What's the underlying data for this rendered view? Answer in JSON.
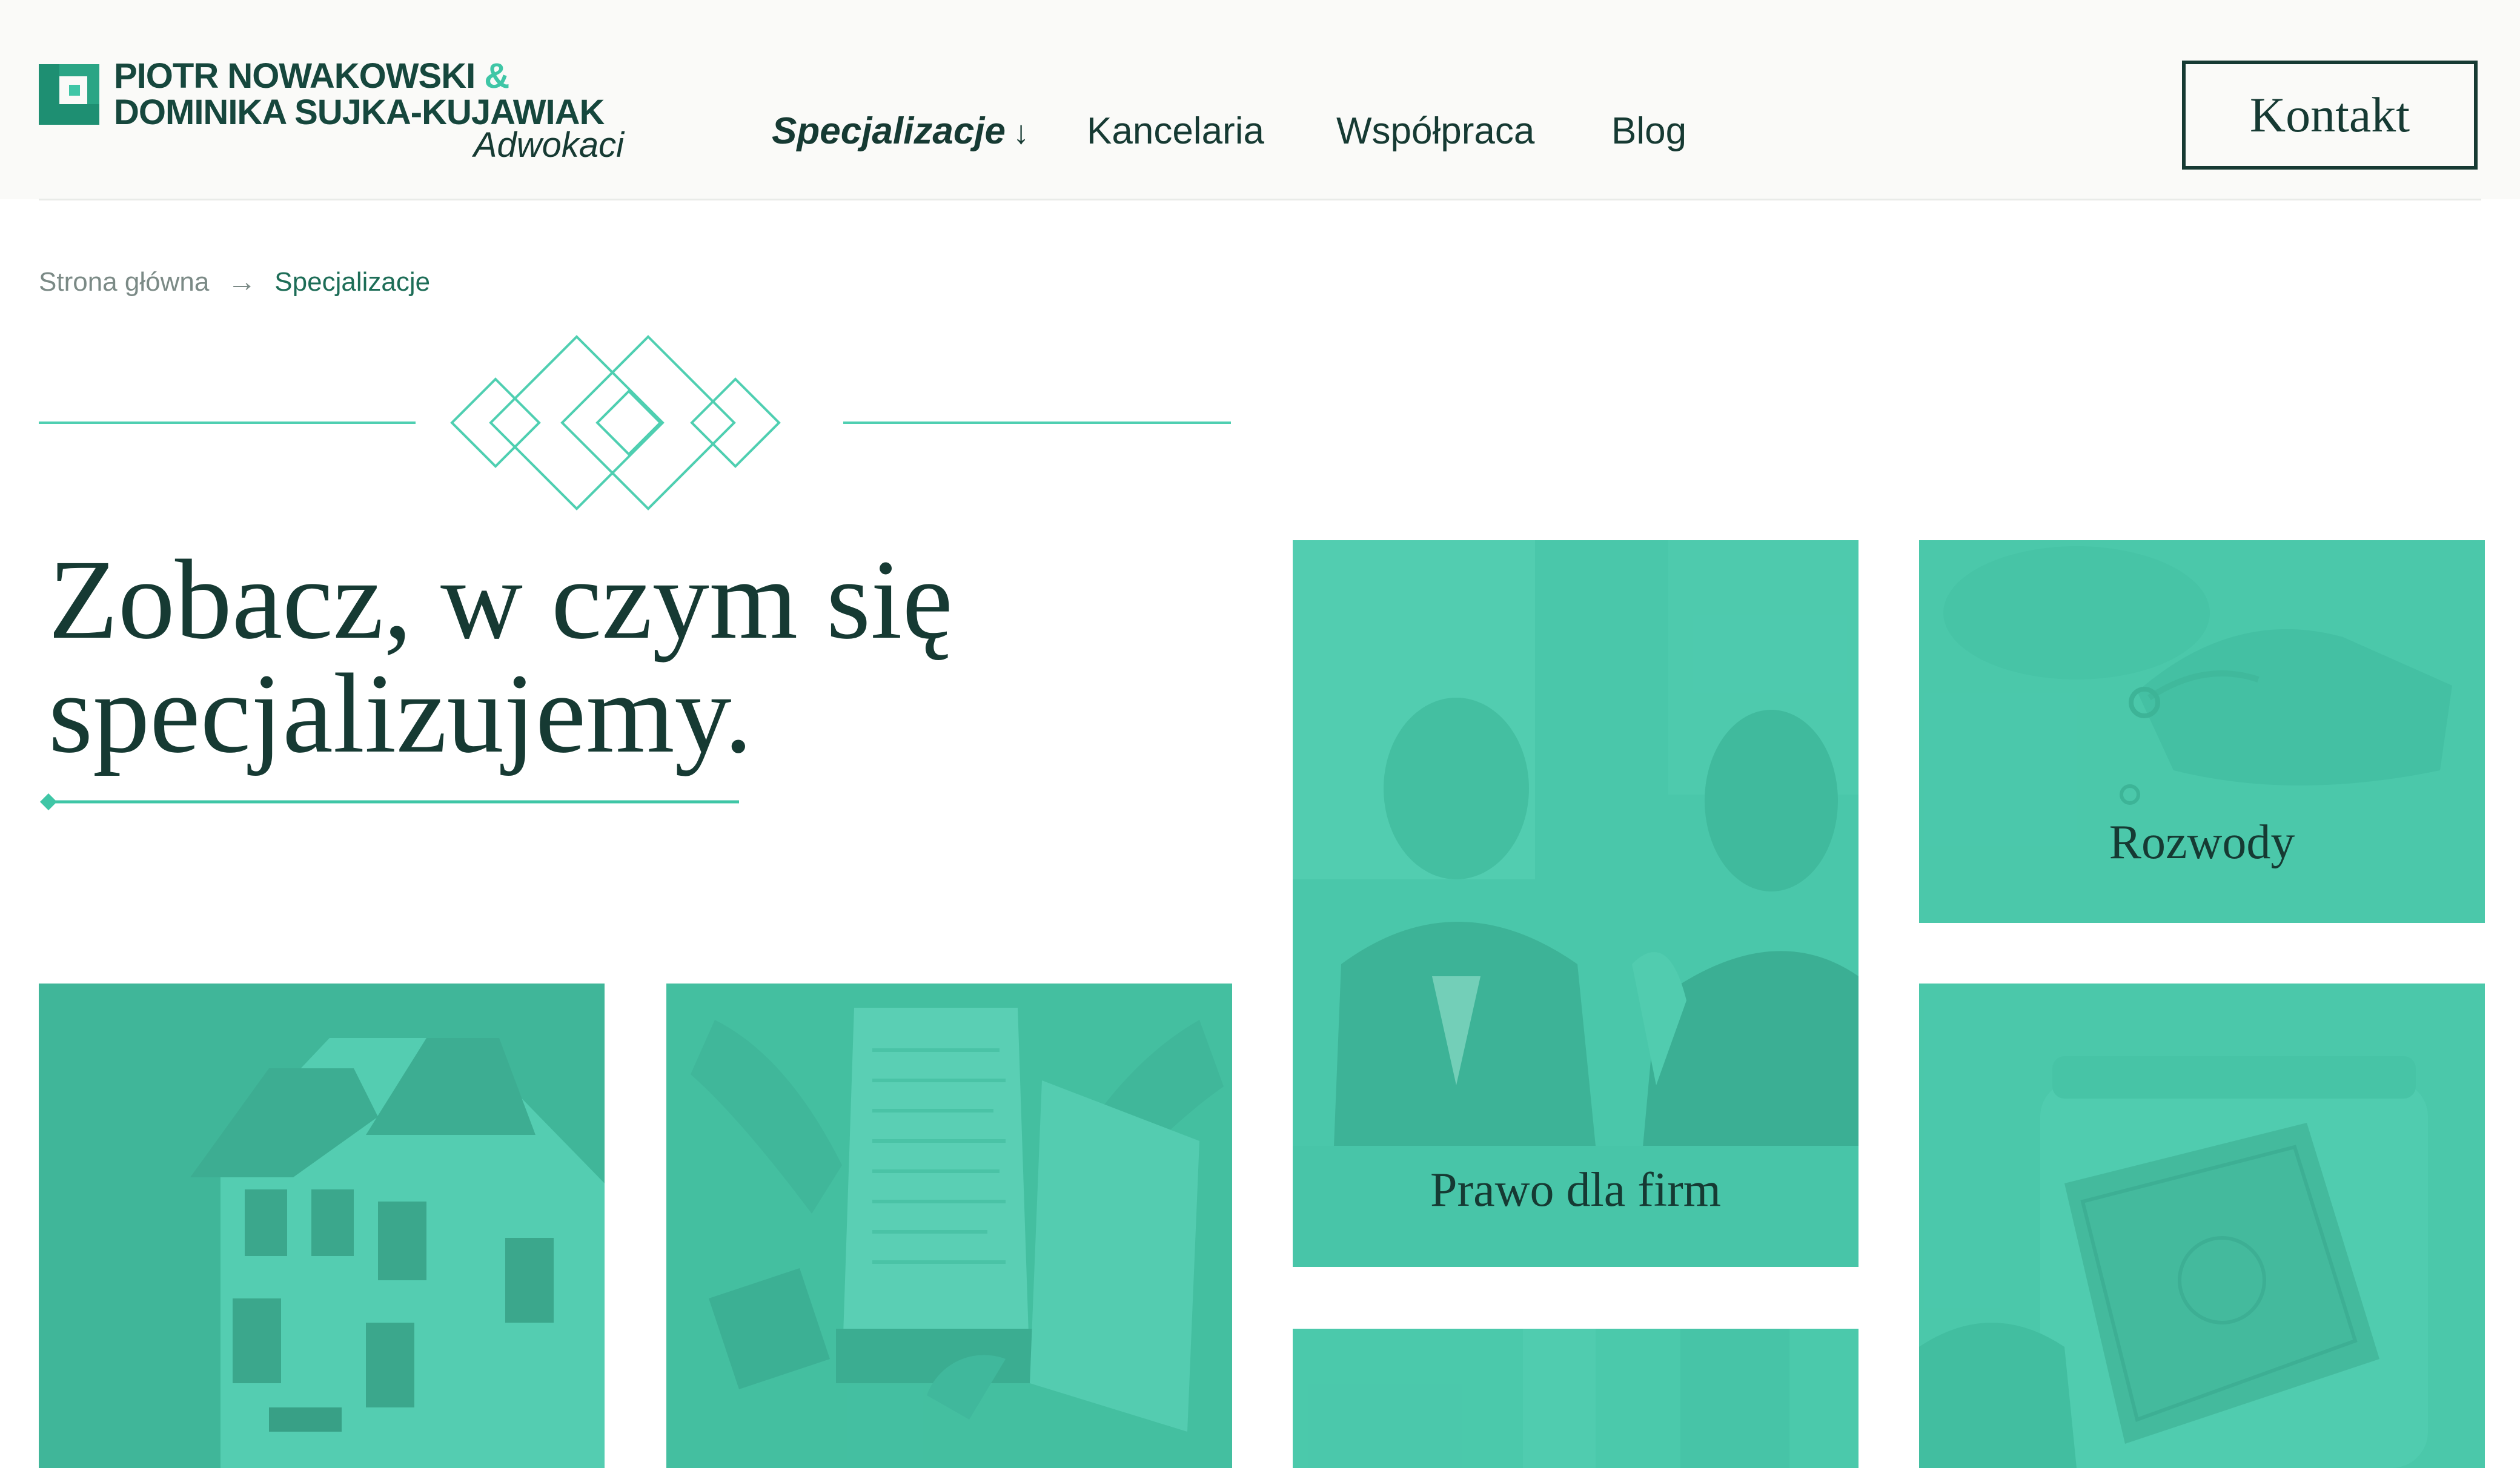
{
  "brand": {
    "line1": "PIOTR NOWAKOWSKI",
    "amp": "&",
    "line2": "DOMINIKA SUJKA-KUJAWIAK",
    "subtitle": "Adwokaci",
    "accent_color": "#3fc6a6",
    "dark_color": "#163a33"
  },
  "nav": {
    "items": [
      {
        "label": "Specjalizacje",
        "arrow": "↓"
      },
      {
        "label": "Kancelaria"
      },
      {
        "label": "Współpraca"
      },
      {
        "label": "Blog"
      }
    ],
    "contact_label": "Kontakt"
  },
  "breadcrumb": {
    "home": "Strona główna",
    "separator": "→",
    "current": "Specjalizacje"
  },
  "hero": {
    "title_line1": "Zobacz, w czym się",
    "title_line2": "specjalizujemy."
  },
  "cards": [
    {
      "label": "Prawo dla firm",
      "image": "business-meeting-photo"
    },
    {
      "label": "Rozwody",
      "image": "wedding-ring-hands-photo"
    },
    {
      "label": "",
      "image": "house-photo"
    },
    {
      "label": "",
      "image": "contract-signing-photo"
    },
    {
      "label": "",
      "image": "office-photo"
    },
    {
      "label": "",
      "image": "money-jar-photo"
    }
  ],
  "colors": {
    "card_tint": "#47c8ac",
    "header_bg": "#fafaf8"
  }
}
